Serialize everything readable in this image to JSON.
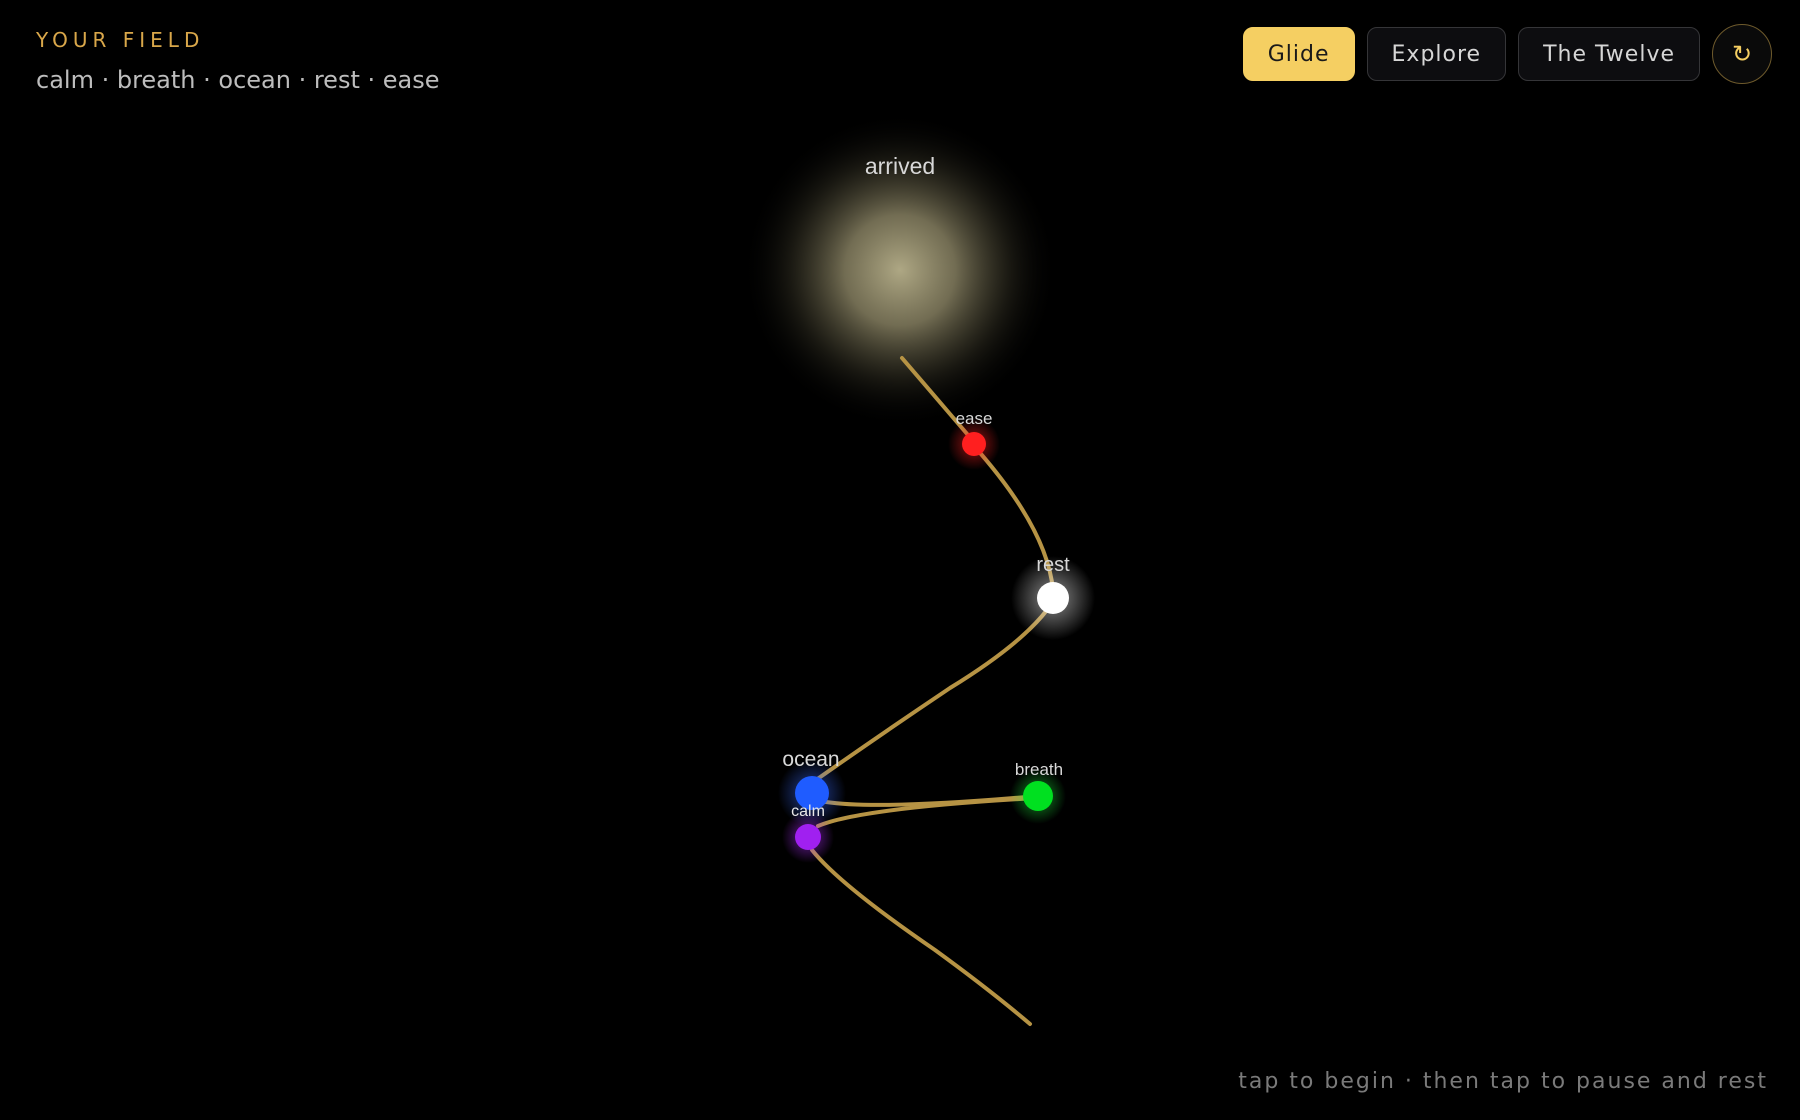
{
  "header": {
    "title": "YOUR FIELD",
    "words": "calm · breath · ocean · rest · ease"
  },
  "controls": {
    "modes": [
      "Glide",
      "Explore",
      "The Twelve"
    ],
    "active_mode": "Glide",
    "reset_icon": "↻"
  },
  "colors": {
    "accent": "#f5cf62",
    "path": "#b69344",
    "arrived": "#e8dfb0",
    "calm": "#a020f0",
    "breath": "#00e020",
    "ocean": "#1f5cff",
    "rest": "#ffffff",
    "ease": "#ff1f1f"
  },
  "nodes": [
    {
      "id": "arrived",
      "label": "arrived",
      "icon": "arrival-glow-icon"
    },
    {
      "id": "ease",
      "label": "ease"
    },
    {
      "id": "rest",
      "label": "rest"
    },
    {
      "id": "ocean",
      "label": "ocean"
    },
    {
      "id": "calm",
      "label": "calm"
    },
    {
      "id": "breath",
      "label": "breath"
    }
  ],
  "hint": "tap to begin · then tap to pause and rest"
}
